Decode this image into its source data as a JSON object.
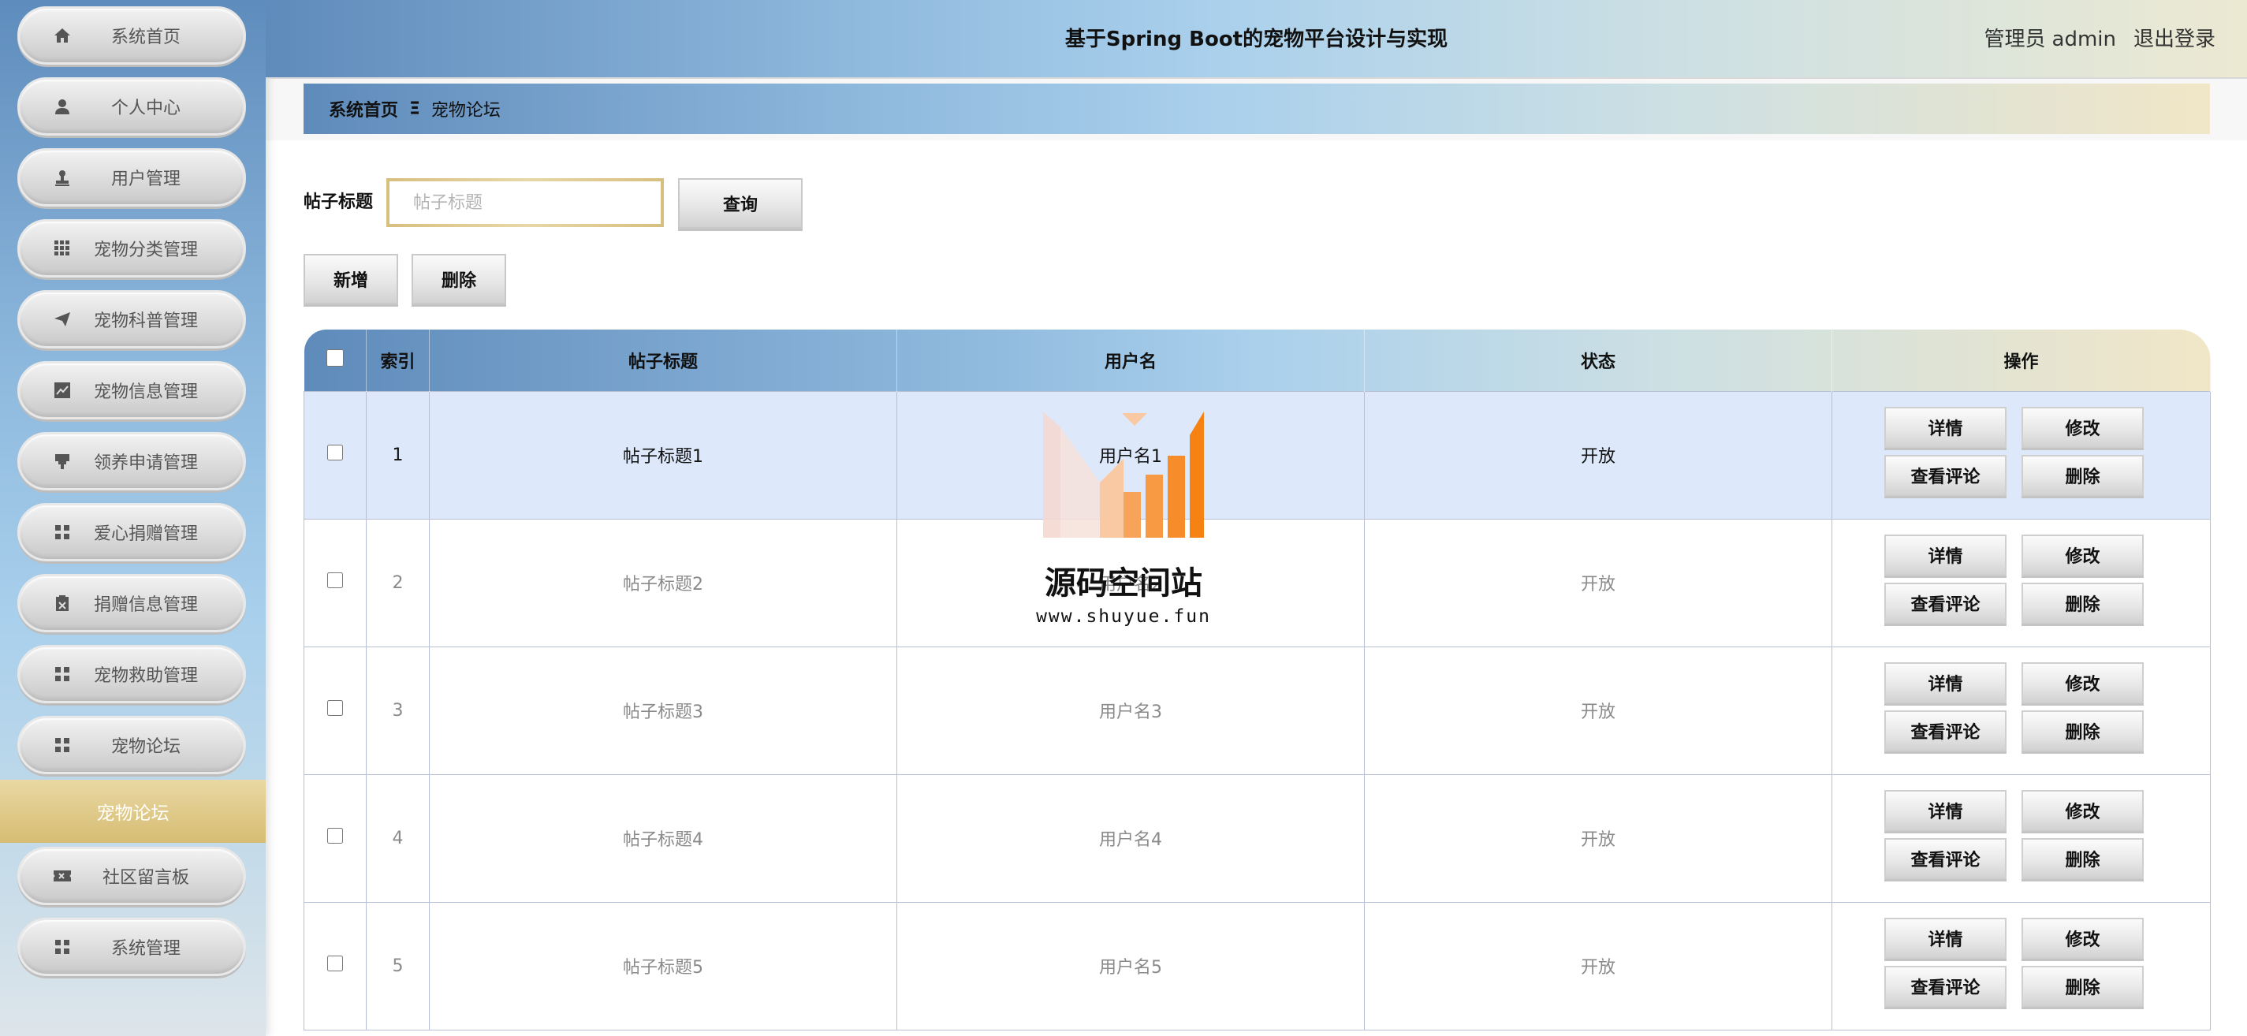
{
  "header": {
    "title": "基于Spring Boot的宠物平台设计与实现",
    "user_role": "管理员",
    "user_name": "admin",
    "logout_label": "退出登录"
  },
  "sidebar": {
    "items": [
      {
        "label": "系统首页",
        "icon": "home-icon"
      },
      {
        "label": "个人中心",
        "icon": "user-icon"
      },
      {
        "label": "用户管理",
        "icon": "stamp-icon"
      },
      {
        "label": "宠物分类管理",
        "icon": "grid-icon"
      },
      {
        "label": "宠物科普管理",
        "icon": "send-icon"
      },
      {
        "label": "宠物信息管理",
        "icon": "chart-icon"
      },
      {
        "label": "领养申请管理",
        "icon": "pin-icon"
      },
      {
        "label": "爱心捐赠管理",
        "icon": "apps-icon"
      },
      {
        "label": "捐赠信息管理",
        "icon": "clipboard-icon"
      },
      {
        "label": "宠物救助管理",
        "icon": "apps-icon"
      },
      {
        "label": "宠物论坛",
        "icon": "apps-icon"
      },
      {
        "label": "社区留言板",
        "icon": "ticket-icon"
      },
      {
        "label": "系统管理",
        "icon": "apps-icon"
      }
    ],
    "active_label": "宠物论坛"
  },
  "breadcrumb": {
    "home": "系统首页",
    "separator": "Ξ",
    "current": "宠物论坛"
  },
  "search": {
    "label": "帖子标题",
    "placeholder": "帖子标题",
    "button_label": "查询"
  },
  "toolbar": {
    "add_label": "新增",
    "delete_label": "删除"
  },
  "table": {
    "columns": [
      "索引",
      "帖子标题",
      "用户名",
      "状态",
      "操作"
    ],
    "rows": [
      {
        "index": "1",
        "title": "帖子标题1",
        "user": "用户名1",
        "status": "开放"
      },
      {
        "index": "2",
        "title": "帖子标题2",
        "user": "用户名2",
        "status": "开放"
      },
      {
        "index": "3",
        "title": "帖子标题3",
        "user": "用户名3",
        "status": "开放"
      },
      {
        "index": "4",
        "title": "帖子标题4",
        "user": "用户名4",
        "status": "开放"
      },
      {
        "index": "5",
        "title": "帖子标题5",
        "user": "用户名5",
        "status": "开放"
      }
    ],
    "actions": {
      "detail": "详情",
      "edit": "修改",
      "view_comments": "查看评论",
      "delete": "删除"
    }
  },
  "watermark": {
    "title": "源码空间站",
    "url": "www.shuyue.fun"
  },
  "colors": {
    "header_gradient_start": "#5f8bbb",
    "header_gradient_mid": "#aad0ec",
    "header_gradient_end": "#ece9d2",
    "active_menu": "#d7bd73",
    "highlight_row": "#dde9fb"
  }
}
